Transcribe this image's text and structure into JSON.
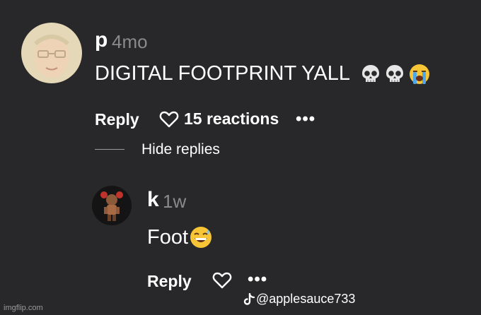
{
  "comment": {
    "username": "p",
    "time": "4mo",
    "text": "DIGITAL FOOTPRINT YALL",
    "emojis": [
      "skull-emoji",
      "skull-emoji",
      "loudly-crying-emoji"
    ],
    "reply_label": "Reply",
    "reactions_label": "15 reactions",
    "more_label": "•••"
  },
  "replies_toggle": {
    "label": "Hide replies"
  },
  "reply": {
    "username": "k",
    "time": "1w",
    "text": "Foot",
    "emojis": [
      "grinning-sweat-emoji"
    ],
    "reply_label": "Reply",
    "more_label": "•••"
  },
  "watermark": {
    "text": "imgflip.com"
  },
  "credit": {
    "handle": "@applesauce733",
    "icon": "tiktok-icon"
  }
}
